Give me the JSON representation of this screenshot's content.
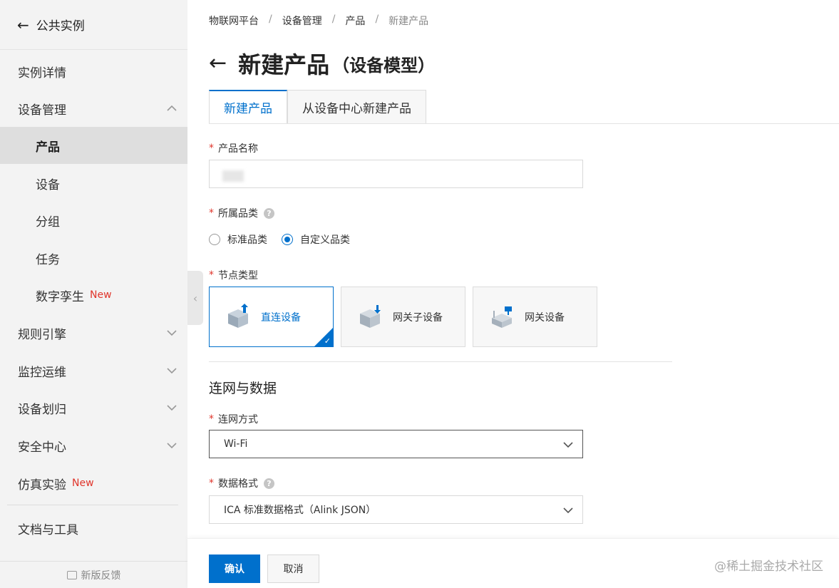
{
  "sidebar": {
    "back_label": "公共实例",
    "items": [
      {
        "label": "实例详情"
      },
      {
        "label": "设备管理"
      },
      {
        "label": "产品"
      },
      {
        "label": "设备"
      },
      {
        "label": "分组"
      },
      {
        "label": "任务"
      },
      {
        "label": "数字孪生",
        "badge": "New"
      },
      {
        "label": "规则引擎"
      },
      {
        "label": "监控运维"
      },
      {
        "label": "设备划归"
      },
      {
        "label": "安全中心"
      },
      {
        "label": "仿真实验",
        "badge": "New"
      },
      {
        "label": "文档与工具"
      }
    ],
    "footer": "新版反馈"
  },
  "breadcrumb": [
    "物联网平台",
    "设备管理",
    "产品",
    "新建产品"
  ],
  "page": {
    "title": "新建产品",
    "subtitle": "（设备模型）"
  },
  "tabs": [
    "新建产品",
    "从设备中心新建产品"
  ],
  "form": {
    "product_name_label": "产品名称",
    "category_label": "所属品类",
    "category_options": [
      "标准品类",
      "自定义品类"
    ],
    "node_type_label": "节点类型",
    "node_types": [
      "直连设备",
      "网关子设备",
      "网关设备"
    ],
    "section_title": "连网与数据",
    "network_label": "连网方式",
    "network_value": "Wi-Fi",
    "data_format_label": "数据格式",
    "data_format_value": "ICA 标准数据格式（Alink JSON）"
  },
  "actions": {
    "confirm": "确认",
    "cancel": "取消"
  },
  "watermark": "@稀土掘金技术社区",
  "colors": {
    "accent": "#0070cc",
    "required": "#e0352b",
    "badge_new": "#e0352b"
  }
}
